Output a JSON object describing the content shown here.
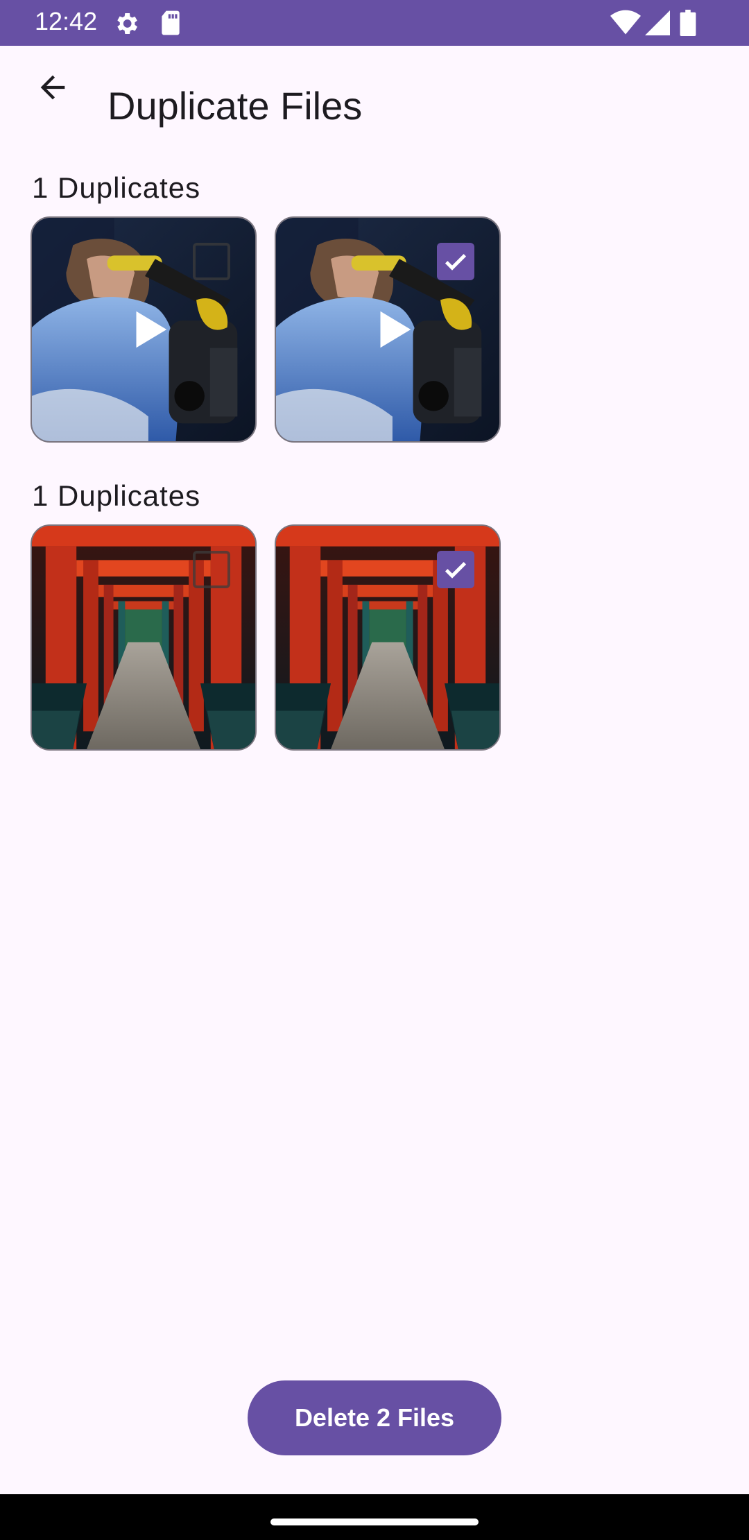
{
  "status_bar": {
    "time": "12:42",
    "icons": [
      "settings-icon",
      "sd-card-icon",
      "wifi-icon",
      "signal-icon",
      "battery-icon"
    ],
    "background": "#6750A4"
  },
  "app_bar": {
    "title": "Duplicate Files",
    "back_icon": "arrow-back-icon"
  },
  "groups": [
    {
      "title": "1 Duplicates",
      "items": [
        {
          "type": "video",
          "scene": "lab-scientist",
          "selected": false
        },
        {
          "type": "video",
          "scene": "lab-scientist",
          "selected": true
        }
      ]
    },
    {
      "title": "1 Duplicates",
      "items": [
        {
          "type": "image",
          "scene": "torii-gates",
          "selected": false
        },
        {
          "type": "image",
          "scene": "torii-gates",
          "selected": true
        }
      ]
    }
  ],
  "actions": {
    "delete_label": "Delete 2 Files"
  },
  "colors": {
    "primary": "#6750A4",
    "background": "#FEF7FF"
  }
}
